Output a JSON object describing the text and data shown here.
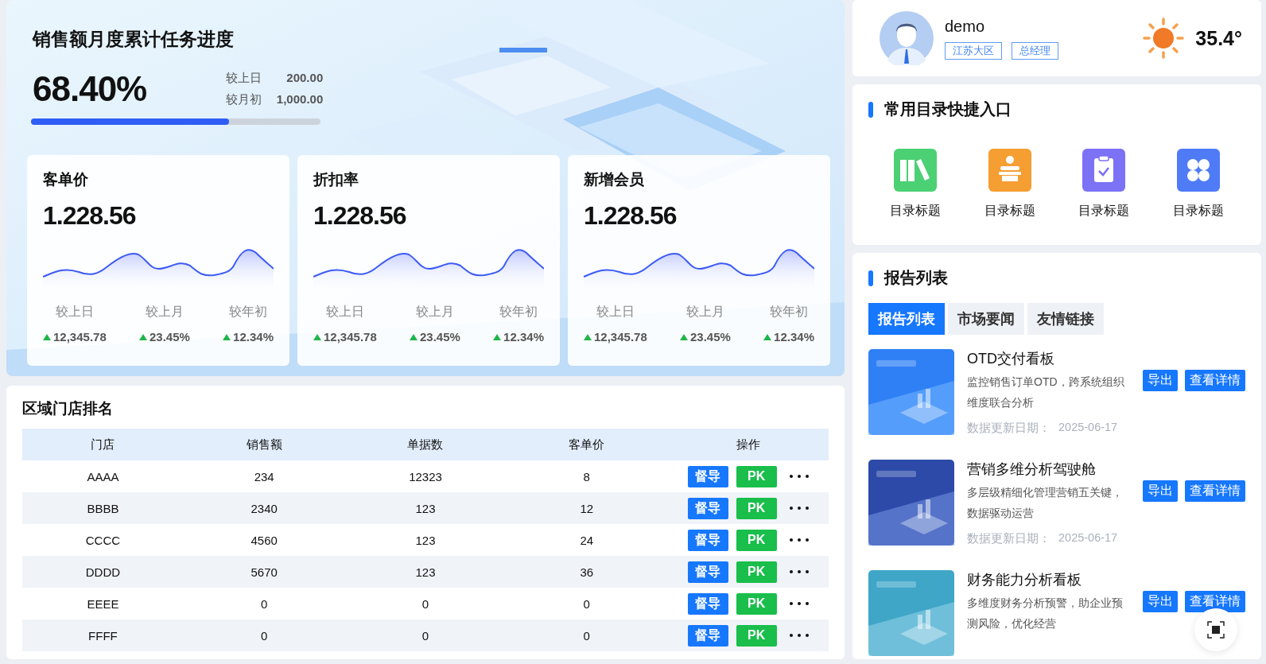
{
  "progress": {
    "title": "销售额月度累计任务进度",
    "value": "68.40%",
    "level": 0.684,
    "compare": [
      {
        "label": "较上日",
        "value": "200.00"
      },
      {
        "label": "较月初",
        "value": "1,000.00"
      }
    ]
  },
  "metric_cards": [
    {
      "title": "客单价",
      "value": "1.228.56",
      "stats": [
        {
          "label": "较上日",
          "value": "12,345.78",
          "rising": true
        },
        {
          "label": "较上月",
          "value": "23.45%",
          "rising": true
        },
        {
          "label": "较年初",
          "value": "12.34%",
          "rising": true
        }
      ]
    },
    {
      "title": "折扣率",
      "value": "1.228.56",
      "stats": [
        {
          "label": "较上日",
          "value": "12,345.78",
          "rising": true
        },
        {
          "label": "较上月",
          "value": "23.45%",
          "rising": true
        },
        {
          "label": "较年初",
          "value": "12.34%",
          "rising": true
        }
      ]
    },
    {
      "title": "新增会员",
      "value": "1.228.56",
      "stats": [
        {
          "label": "较上日",
          "value": "12,345.78",
          "rising": true
        },
        {
          "label": "较上月",
          "value": "23.45%",
          "rising": true
        },
        {
          "label": "较年初",
          "value": "12.34%",
          "rising": true
        }
      ]
    }
  ],
  "store_ranking": {
    "title": "区域门店排名",
    "columns": [
      "门店",
      "销售额",
      "单据数",
      "客单价",
      "操作"
    ],
    "rows": [
      {
        "cells": [
          "AAAA",
          "234",
          "12323",
          "8"
        ],
        "actions": [
          "督导",
          "PK"
        ]
      },
      {
        "cells": [
          "BBBB",
          "2340",
          "123",
          "12"
        ],
        "actions": [
          "督导",
          "PK"
        ]
      },
      {
        "cells": [
          "CCCC",
          "4560",
          "123",
          "24"
        ],
        "actions": [
          "督导",
          "PK"
        ]
      },
      {
        "cells": [
          "DDDD",
          "5670",
          "123",
          "36"
        ],
        "actions": [
          "督导",
          "PK"
        ]
      },
      {
        "cells": [
          "EEEE",
          "0",
          "0",
          "0"
        ],
        "actions": [
          "督导",
          "PK"
        ]
      },
      {
        "cells": [
          "FFFF",
          "0",
          "0",
          "0"
        ],
        "actions": [
          "督导",
          "PK"
        ]
      }
    ]
  },
  "profile": {
    "name": "demo",
    "tags": [
      "江苏大区",
      "总经理"
    ]
  },
  "weather": {
    "temperature": "35.4°"
  },
  "shortcuts": {
    "title": "常用目录快捷入口",
    "items": [
      {
        "label": "目录标题",
        "kind": "books",
        "color": "#4cd074"
      },
      {
        "label": "目录标题",
        "kind": "speaker",
        "color": "#f59e32"
      },
      {
        "label": "目录标题",
        "kind": "clipboard",
        "color": "#7b72f5"
      },
      {
        "label": "目录标题",
        "kind": "grid",
        "color": "#4f7bf7"
      }
    ]
  },
  "reports": {
    "title": "报告列表",
    "tabs": [
      {
        "label": "报告列表",
        "selected": true
      },
      {
        "label": "市场要闻",
        "selected": false
      },
      {
        "label": "友情链接",
        "selected": false
      }
    ],
    "items": [
      {
        "title": "OTD交付看板",
        "description": "监控销售订单OTD，跨系统组织维度联合分析",
        "date_label": "数据更新日期：",
        "date": "2025-06-17",
        "buttons": [
          "导出",
          "查看详情"
        ]
      },
      {
        "title": "营销多维分析驾驶舱",
        "description": "多层级精细化管理营销五关键，数据驱动运营",
        "date_label": "数据更新日期：",
        "date": "2025-06-17",
        "buttons": [
          "导出",
          "查看详情"
        ]
      },
      {
        "title": "财务能力分析看板",
        "description": "多维度财务分析预警，助企业预测风险，优化经营",
        "buttons": [
          "导出",
          "查看详情"
        ]
      }
    ]
  }
}
